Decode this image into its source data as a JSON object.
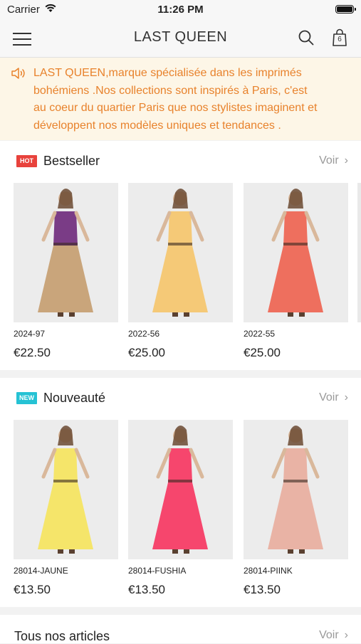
{
  "status_bar": {
    "carrier": "Carrier",
    "time": "11:26 PM",
    "wifi_icon": "wifi-icon",
    "battery_icon": "battery-icon"
  },
  "nav": {
    "title": "LAST QUEEN",
    "menu_icon": "hamburger-icon",
    "search_icon": "search-icon",
    "cart_icon": "shopping-bag-icon",
    "cart_count": "6"
  },
  "announcement": {
    "icon": "speaker-icon",
    "lines": [
      "LAST QUEEN,marque spécialisée dans les imprimés",
      "bohémiens .Nos collections sont inspirés à Paris, c'est",
      "au coeur du quartier Paris que nos stylistes imaginent et",
      "développent nos modèles uniques et tendances ."
    ]
  },
  "sections": {
    "bestseller": {
      "badge": "HOT",
      "badge_color": "#e8423c",
      "title": "Bestseller",
      "more": "Voir",
      "products": [
        {
          "code": "2024-97",
          "price": "€22.50",
          "colors": [
            "#7a3c86",
            "#c9a57b"
          ]
        },
        {
          "code": "2022-56",
          "price": "€25.00",
          "colors": [
            "#f5c977",
            "#f5c977"
          ]
        },
        {
          "code": "2022-55",
          "price": "€25.00",
          "colors": [
            "#ee6f5e",
            "#ee6f5e"
          ]
        }
      ]
    },
    "nouveaute": {
      "badge": "NEW",
      "badge_color": "#25c2d4",
      "title": "Nouveauté",
      "more": "Voir",
      "products": [
        {
          "code": "28014-JAUNE",
          "price": "€13.50",
          "colors": [
            "#f5e56a",
            "#f5e56a"
          ]
        },
        {
          "code": "28014-FUSHIA",
          "price": "€13.50",
          "colors": [
            "#f6466d",
            "#f6466d"
          ]
        },
        {
          "code": "28014-PIINK",
          "price": "€13.50",
          "colors": [
            "#e9b3a5",
            "#e9b3a5"
          ]
        }
      ]
    }
  },
  "all_articles": {
    "title": "Tous nos articles",
    "more": "Voir"
  }
}
